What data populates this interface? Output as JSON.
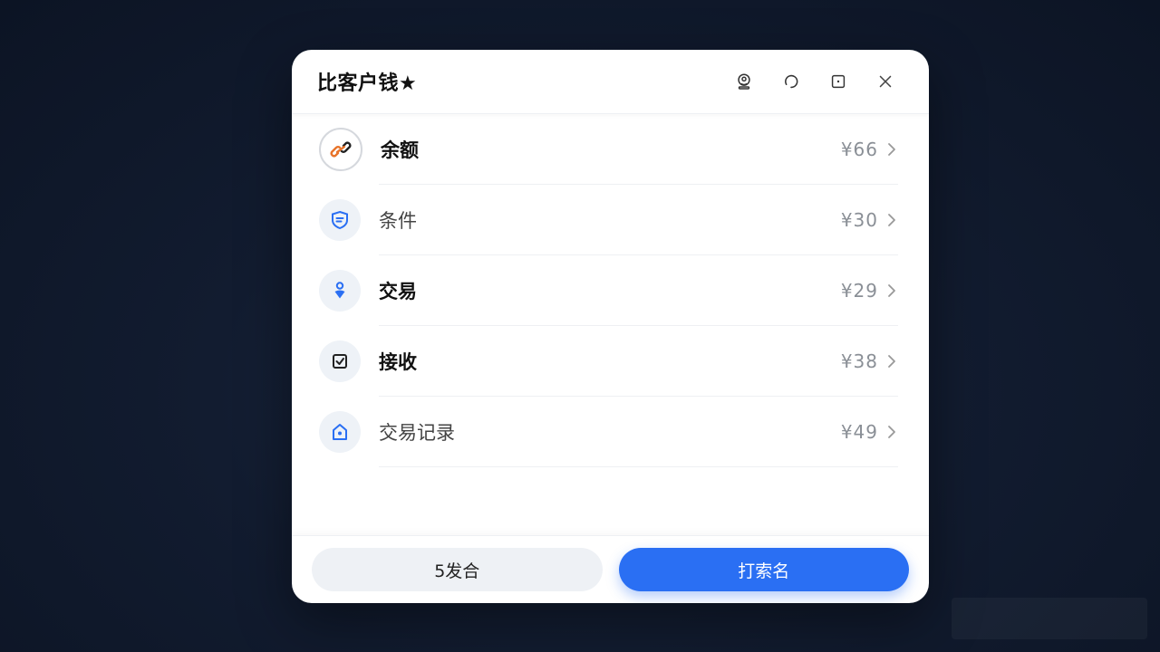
{
  "dialog": {
    "title": "比客户钱★",
    "window_controls": [
      {
        "name": "support-icon"
      },
      {
        "name": "refresh-icon"
      },
      {
        "name": "maximize-icon"
      },
      {
        "name": "close-icon"
      }
    ]
  },
  "list": {
    "items": [
      {
        "label": "余额",
        "value": "¥66",
        "icon": "link-chain-icon",
        "style": "bold"
      },
      {
        "label": "条件",
        "value": "¥30",
        "icon": "message-shield-icon",
        "style": "light"
      },
      {
        "label": "交易",
        "value": "¥29",
        "icon": "location-pin-icon",
        "style": "bold"
      },
      {
        "label": "接收",
        "value": "¥38",
        "icon": "checkbox-icon",
        "style": "bold"
      },
      {
        "label": "交易记录",
        "value": "¥49",
        "icon": "home-lock-icon",
        "style": "light"
      }
    ]
  },
  "footer": {
    "secondary_label": "5发合",
    "primary_label": "打索名"
  },
  "colors": {
    "primary": "#2a6ff3",
    "accent_orange": "#e8742a",
    "icon_blue": "#2a6ff3"
  }
}
